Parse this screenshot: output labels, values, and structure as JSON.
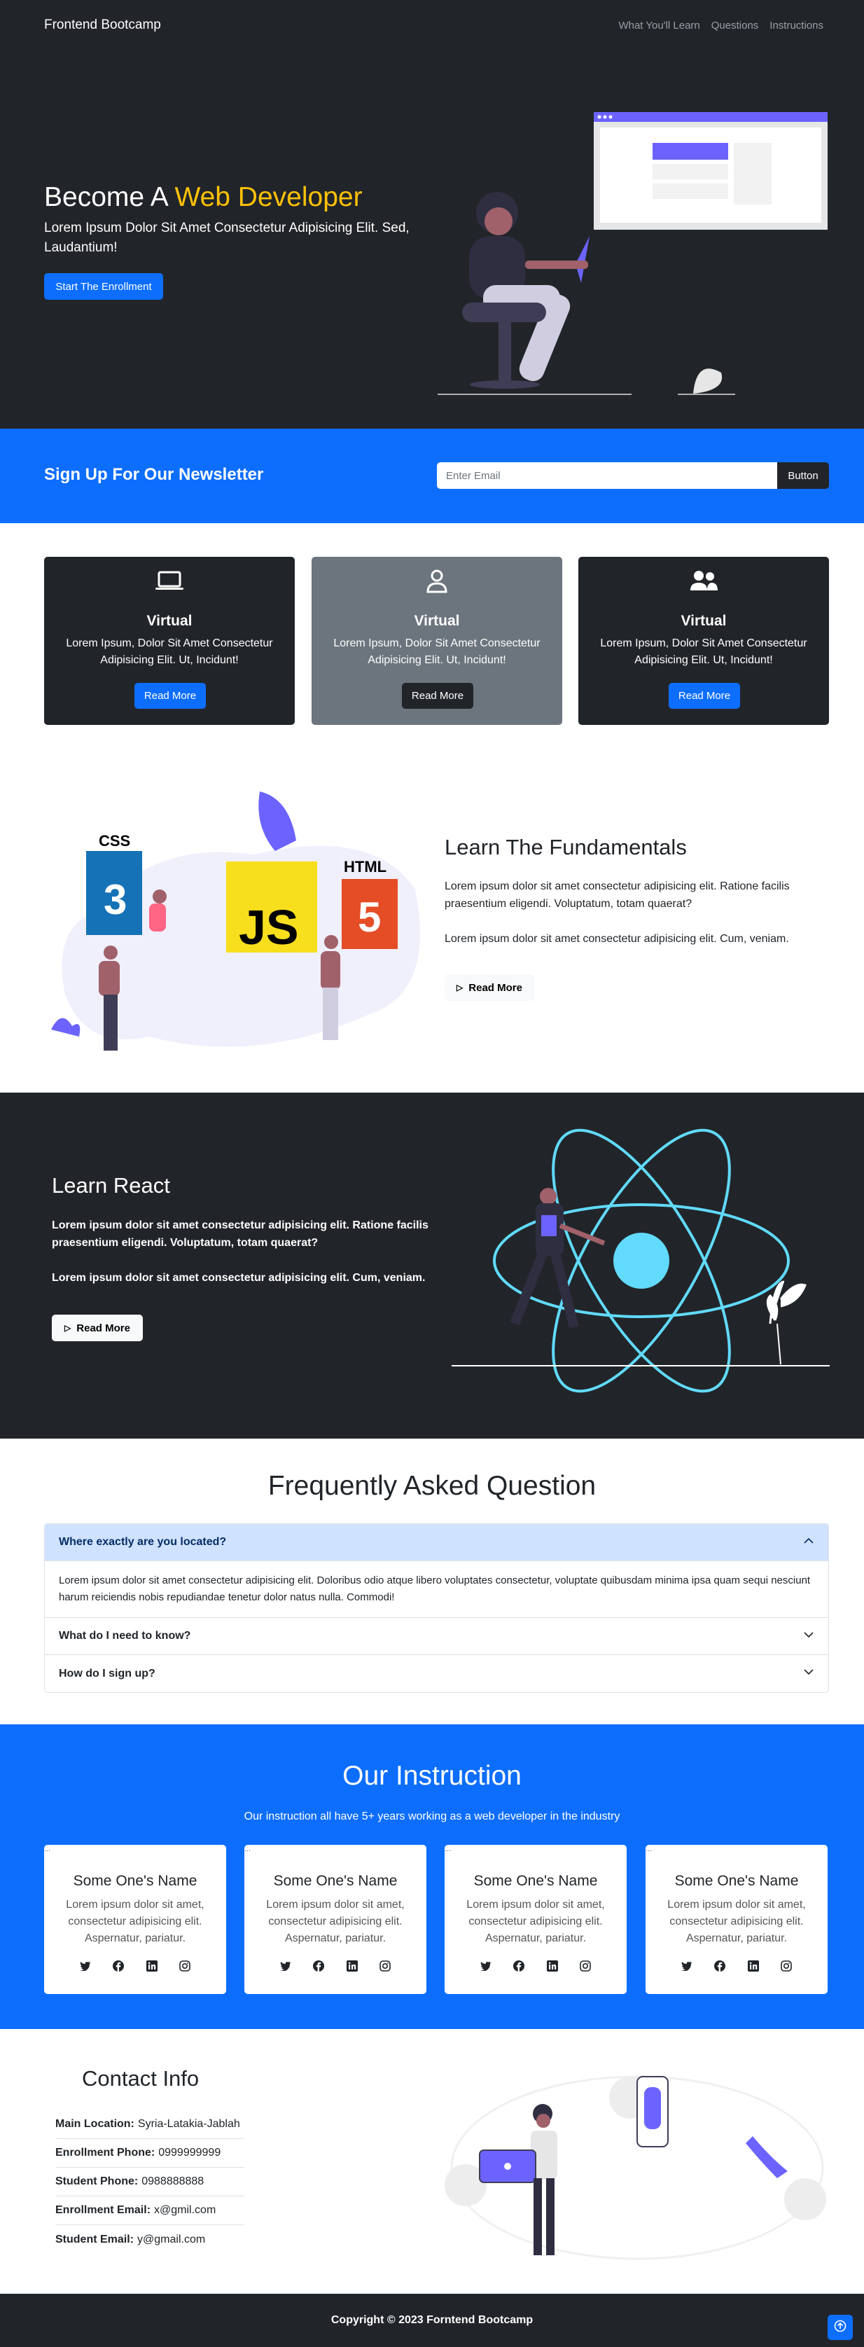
{
  "nav": {
    "brand": "Frontend Bootcamp",
    "links": [
      "What You'll Learn",
      "Questions",
      "Instructions"
    ]
  },
  "hero": {
    "title_prefix": "Become A",
    "title_accent": "Web Developer",
    "subtitle": "Lorem Ipsum Dolor Sit Amet Consectetur Adipisicing Elit. Sed, Laudantium!",
    "cta": "Start The Enrollment"
  },
  "newsletter": {
    "title": "Sign Up For Our Newsletter",
    "placeholder": "Enter Email",
    "button": "Button"
  },
  "cards": [
    {
      "icon": "laptop-icon",
      "title": "Virtual",
      "text": "Lorem Ipsum, Dolor Sit Amet Consectetur Adipisicing Elit. Ut, Incidunt!",
      "button": "Read More"
    },
    {
      "icon": "person-icon",
      "title": "Virtual",
      "text": "Lorem Ipsum, Dolor Sit Amet Consectetur Adipisicing Elit. Ut, Incidunt!",
      "button": "Read More"
    },
    {
      "icon": "people-icon",
      "title": "Virtual",
      "text": "Lorem Ipsum, Dolor Sit Amet Consectetur Adipisicing Elit. Ut, Incidunt!",
      "button": "Read More"
    }
  ],
  "fundamentals": {
    "title": "Learn The Fundamentals",
    "p1": "Lorem ipsum dolor sit amet consectetur adipisicing elit. Ratione facilis praesentium eligendi. Voluptatum, totam quaerat?",
    "p2": "Lorem ipsum dolor sit amet consectetur adipisicing elit. Cum, veniam.",
    "button": "Read More",
    "logo_css": "CSS",
    "logo_js": "JS",
    "logo_html": "HTML"
  },
  "react": {
    "title": "Learn React",
    "p1": "Lorem ipsum dolor sit amet consectetur adipisicing elit. Ratione facilis praesentium eligendi. Voluptatum, totam quaerat?",
    "p2": "Lorem ipsum dolor sit amet consectetur adipisicing elit. Cum, veniam.",
    "button": "Read More"
  },
  "faq": {
    "title": "Frequently Asked Question",
    "items": [
      {
        "q": "Where exactly are you located?",
        "a": "Lorem ipsum dolor sit amet consectetur adipisicing elit. Doloribus odio atque libero voluptates consectetur, voluptate quibusdam minima ipsa quam sequi nesciunt harum reiciendis nobis repudiandae tenetur dolor natus nulla. Commodi!",
        "open": true
      },
      {
        "q": "What do I need to know?",
        "open": false
      },
      {
        "q": "How do I sign up?",
        "open": false
      }
    ]
  },
  "instruction": {
    "title": "Our Instruction",
    "subtitle": "Our instruction all have 5+ years working as a web developer in the industry",
    "people": [
      {
        "img_alt": "...",
        "name": "Some One's Name",
        "bio": "Lorem ipsum dolor sit amet, consectetur adipisicing elit. Aspernatur, pariatur."
      },
      {
        "img_alt": "...",
        "name": "Some One's Name",
        "bio": "Lorem ipsum dolor sit amet, consectetur adipisicing elit. Aspernatur, pariatur."
      },
      {
        "img_alt": "...",
        "name": "Some One's Name",
        "bio": "Lorem ipsum dolor sit amet, consectetur adipisicing elit. Aspernatur, pariatur."
      },
      {
        "img_alt": "...",
        "name": "Some One's Name",
        "bio": "Lorem ipsum dolor sit amet, consectetur adipisicing elit. Aspernatur, pariatur."
      }
    ],
    "social_icons": [
      "twitter-icon",
      "facebook-icon",
      "linkedin-icon",
      "instagram-icon"
    ]
  },
  "contact": {
    "title": "Contact Info",
    "rows": [
      {
        "label": "Main Location:",
        "value": "Syria-Latakia-Jablah"
      },
      {
        "label": "Enrollment Phone:",
        "value": "0999999999"
      },
      {
        "label": "Student Phone:",
        "value": "0988888888"
      },
      {
        "label": "Enrollment Email:",
        "value": "x@gmil.com"
      },
      {
        "label": "Student Email:",
        "value": "y@gmail.com"
      }
    ]
  },
  "footer": {
    "copyright": "Copyright © 2023 Forntend Bootcamp"
  },
  "colors": {
    "primary": "#0d6efd",
    "dark": "#212529",
    "accent": "#ffc107",
    "illustration": "#6c63ff",
    "react": "#61dafb"
  }
}
